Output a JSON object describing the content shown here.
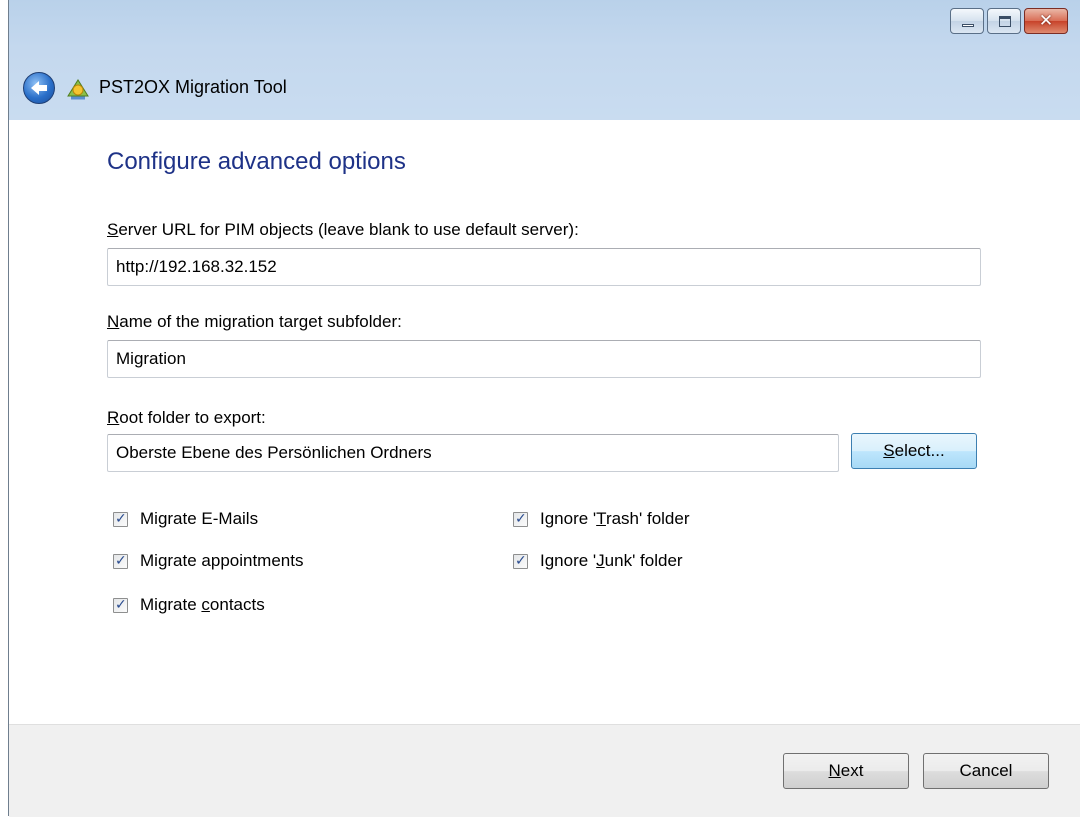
{
  "window": {
    "title": "PST2OX Migration Tool",
    "caption": {
      "minimize": "",
      "maximize": "",
      "close": "✕"
    }
  },
  "page": {
    "heading": "Configure advanced options"
  },
  "fields": {
    "server_url": {
      "label_prefix": "",
      "label_accel": "S",
      "label_rest": "erver URL for PIM objects (leave blank to use default server):",
      "value": "http://192.168.32.152"
    },
    "subfolder": {
      "label_accel": "N",
      "label_rest": "ame of the migration target subfolder:",
      "value": "Migration"
    },
    "root_folder": {
      "label_accel": "R",
      "label_rest": "oot folder to export:",
      "value": "Oberste Ebene des Persönlichen Ordners",
      "select_accel": "S",
      "select_rest": "elect..."
    }
  },
  "options": {
    "migrate_emails": {
      "label": "Migrate E-Mails",
      "checked": true
    },
    "migrate_appointments": {
      "label": "Migrate appointments",
      "checked": true
    },
    "migrate_contacts": {
      "label_pre": "Migrate ",
      "label_accel": "c",
      "label_rest": "ontacts",
      "checked": true
    },
    "ignore_trash": {
      "label_pre": "Ignore '",
      "label_accel": "T",
      "label_rest": "rash' folder",
      "checked": true
    },
    "ignore_junk": {
      "label_pre": "Ignore '",
      "label_accel": "J",
      "label_rest": "unk' folder",
      "checked": true
    }
  },
  "footer": {
    "next_accel": "N",
    "next_rest": "ext",
    "cancel": "Cancel"
  },
  "colors": {
    "heading": "#1e3287",
    "titlebar": "#c4d8ee",
    "footer": "#f0f0f0"
  }
}
